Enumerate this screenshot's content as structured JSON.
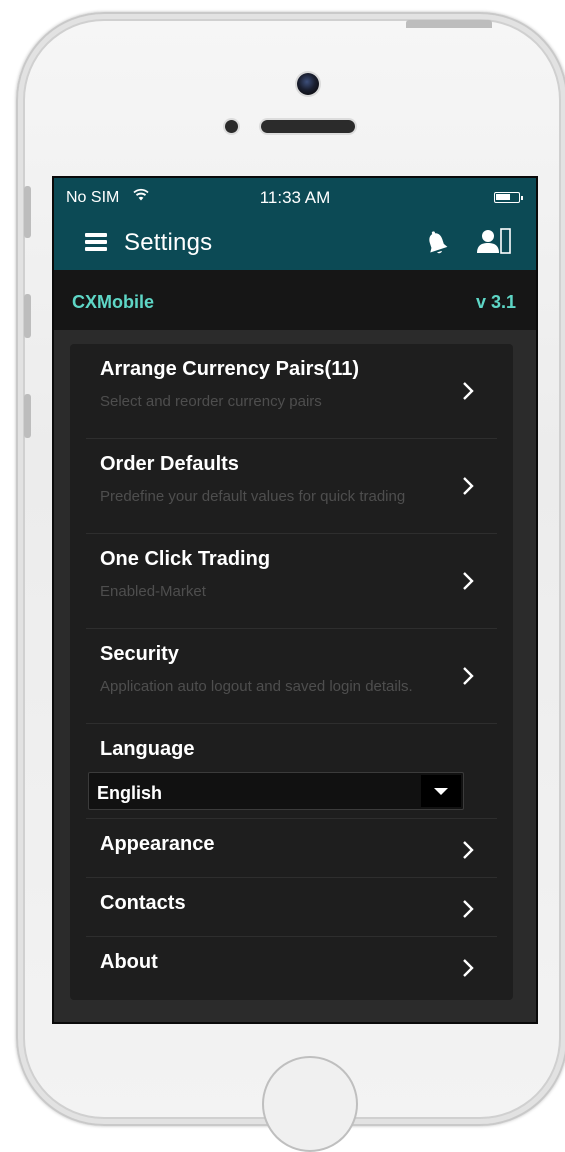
{
  "status_bar": {
    "carrier": "No SIM",
    "wifi_icon": "wifi-icon",
    "time": "11:33 AM",
    "battery_icon": "battery-icon"
  },
  "nav_bar": {
    "title": "Settings",
    "menu_icon": "hamburger-menu-icon",
    "notification_icon": "bell-icon",
    "account_icon": "user-icon"
  },
  "app_bar": {
    "name": "CXMobile",
    "version": "v 3.1"
  },
  "settings": {
    "items": [
      {
        "title": "Arrange Currency Pairs(11)",
        "subtitle": "Select and reorder currency pairs"
      },
      {
        "title": "Order Defaults",
        "subtitle": "Predefine your default values for quick trading"
      },
      {
        "title": "One Click Trading",
        "subtitle": "Enabled-Market"
      },
      {
        "title": "Security",
        "subtitle": "Application auto logout and saved login details."
      },
      {
        "title": "Appearance"
      },
      {
        "title": "Contacts"
      },
      {
        "title": "About"
      }
    ],
    "language": {
      "label": "Language",
      "selected": "English"
    }
  },
  "colors": {
    "header_bg": "#0c4a55",
    "accent": "#5ed6c6",
    "panel_bg": "#1e1e1e",
    "content_bg": "#2b2b2b"
  }
}
